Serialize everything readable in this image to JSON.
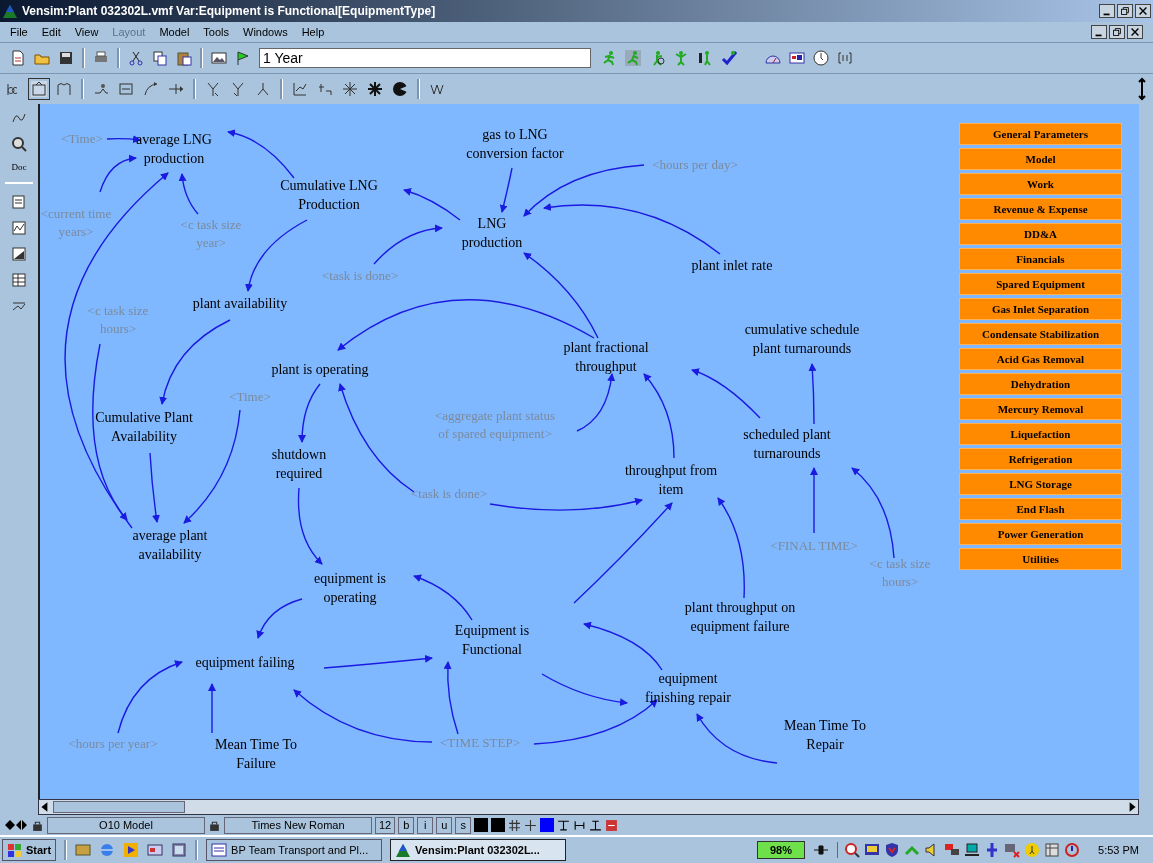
{
  "window": {
    "title": "Vensim:Plant 032302L.vmf Var:Equipment is Functional[EquipmentType]"
  },
  "menu": [
    {
      "label": "File",
      "disabled": false
    },
    {
      "label": "Edit",
      "disabled": false
    },
    {
      "label": "View",
      "disabled": false
    },
    {
      "label": "Layout",
      "disabled": true
    },
    {
      "label": "Model",
      "disabled": false
    },
    {
      "label": "Tools",
      "disabled": false
    },
    {
      "label": "Windows",
      "disabled": false
    },
    {
      "label": "Help",
      "disabled": false
    }
  ],
  "toolbar": {
    "time_field": {
      "value": "1 Year"
    }
  },
  "left_toolbar": {
    "doc_label": "Doc"
  },
  "view_buttons": [
    "General Parameters",
    "Model",
    "Work",
    "Revenue & Expense",
    "DD&A",
    "Financials",
    "Spared Equipment",
    "Gas Inlet Separation",
    "Condensate Stabilization",
    "Acid Gas Removal",
    "Dehydration",
    "Mercury Removal",
    "Liquefaction",
    "Refrigeration",
    "LNG Storage",
    "End Flash",
    "Power Generation",
    "Utilities"
  ],
  "nodes": [
    {
      "text": "<Time>",
      "kind": "shadow"
    },
    {
      "text": "average LNG\nproduction",
      "kind": "variable"
    },
    {
      "text": "gas to LNG\nconversion factor",
      "kind": "variable"
    },
    {
      "text": "<hours per day>",
      "kind": "shadow"
    },
    {
      "text": "Cumulative LNG\nProduction",
      "kind": "variable"
    },
    {
      "text": "<current time\nyears>",
      "kind": "shadow"
    },
    {
      "text": "<c task size\nyear>",
      "kind": "shadow"
    },
    {
      "text": "LNG\nproduction",
      "kind": "variable"
    },
    {
      "text": "<task is done>",
      "kind": "shadow"
    },
    {
      "text": "plant inlet rate",
      "kind": "variable"
    },
    {
      "text": "plant availability",
      "kind": "variable"
    },
    {
      "text": "<c task size\nhours>",
      "kind": "shadow"
    },
    {
      "text": "cumulative schedule\nplant turnarounds",
      "kind": "variable"
    },
    {
      "text": "plant is operating",
      "kind": "variable"
    },
    {
      "text": "plant fractional\nthroughput",
      "kind": "variable"
    },
    {
      "text": "<Time>",
      "kind": "shadow"
    },
    {
      "text": "Cumulative Plant\nAvailability",
      "kind": "variable"
    },
    {
      "text": "<aggregate plant status\nof spared equipment>",
      "kind": "shadow"
    },
    {
      "text": "scheduled plant\nturnarounds",
      "kind": "variable"
    },
    {
      "text": "shutdown\nrequired",
      "kind": "variable"
    },
    {
      "text": "throughput from\nitem",
      "kind": "variable"
    },
    {
      "text": "<task is done>",
      "kind": "shadow"
    },
    {
      "text": "average plant\navailability",
      "kind": "variable"
    },
    {
      "text": "<FINAL TIME>",
      "kind": "shadow"
    },
    {
      "text": "<c task size\nhours>",
      "kind": "shadow"
    },
    {
      "text": "equipment is\noperating",
      "kind": "variable"
    },
    {
      "text": "plant throughput on\nequipment failure",
      "kind": "variable"
    },
    {
      "text": "Equipment is\nFunctional",
      "kind": "variable"
    },
    {
      "text": "equipment failing",
      "kind": "variable"
    },
    {
      "text": "equipment\nfinishing repair",
      "kind": "variable"
    },
    {
      "text": "<hours per year>",
      "kind": "shadow"
    },
    {
      "text": "Mean Time To\nFailure",
      "kind": "variable"
    },
    {
      "text": "<TIME STEP>",
      "kind": "shadow"
    },
    {
      "text": "Mean Time To\nRepair",
      "kind": "variable"
    }
  ],
  "status_bar": {
    "view": "O10 Model",
    "font": "Times New Roman",
    "size": "12",
    "styles": [
      "b",
      "i",
      "u",
      "s"
    ]
  },
  "taskbar": {
    "start": "Start",
    "tasks": [
      {
        "label": "BP Team Transport and Pl...",
        "selected": false
      },
      {
        "label": "Vensim:Plant 032302L...",
        "selected": true
      }
    ],
    "battery": "98%",
    "clock": "5:53 PM"
  }
}
